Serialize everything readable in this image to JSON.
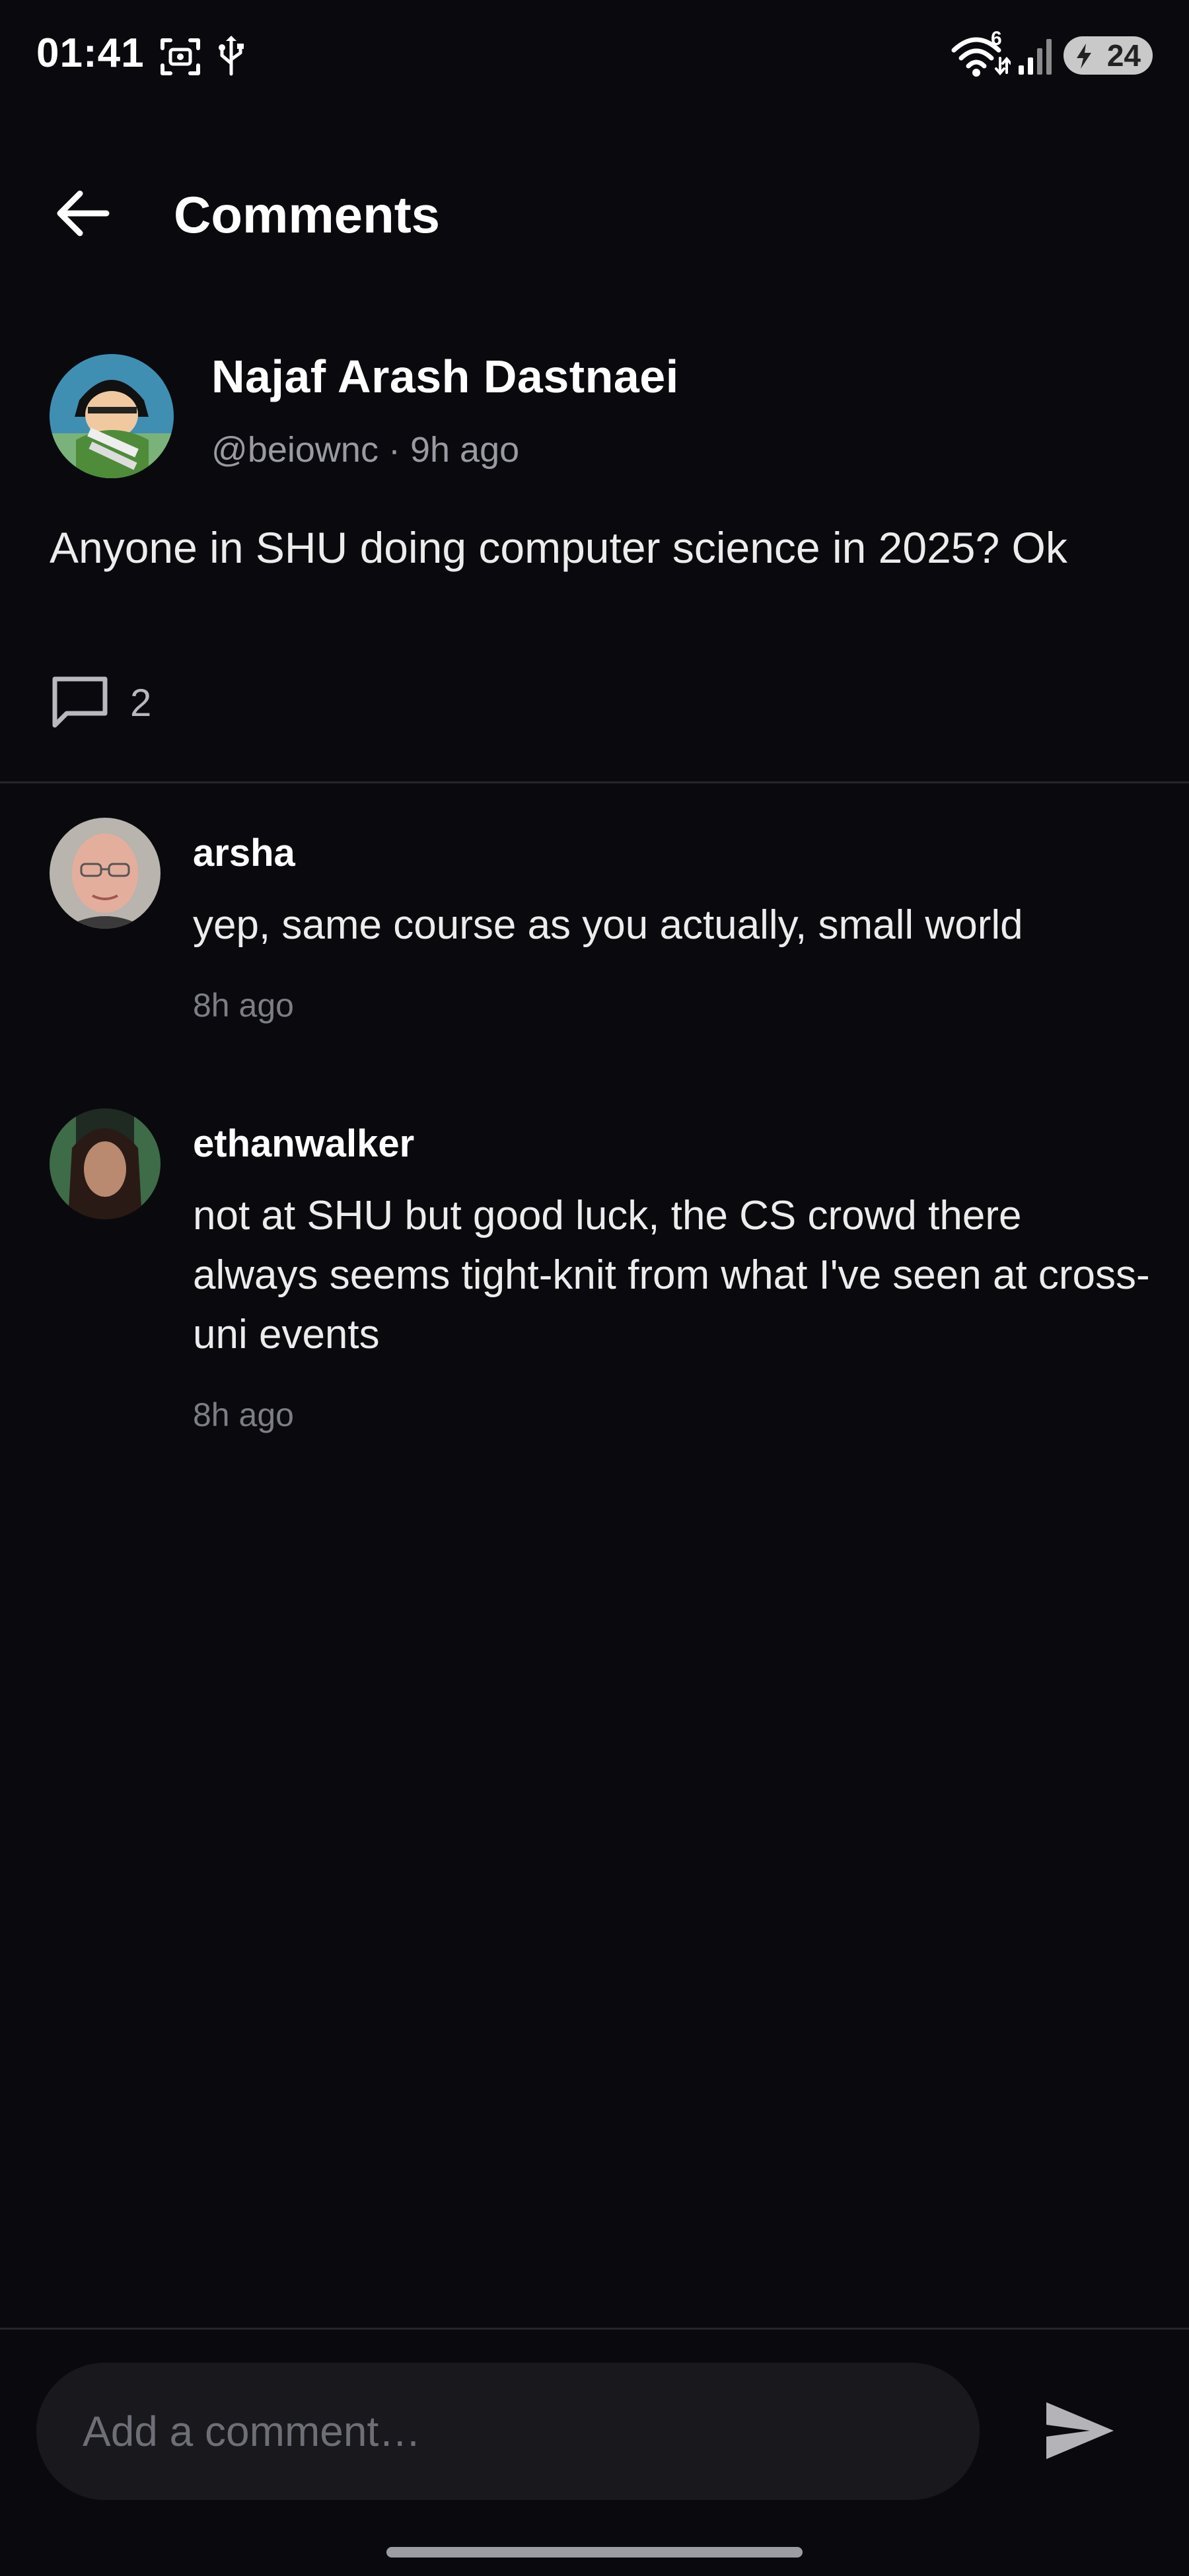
{
  "status_bar": {
    "time": "01:41",
    "battery_level": "24",
    "wifi_badge": "6",
    "icons": [
      "screenshot-icon",
      "usb-icon",
      "wifi-icon",
      "signal-icon",
      "battery-icon"
    ]
  },
  "header": {
    "title": "Comments",
    "back_icon": "arrow-left-icon"
  },
  "post": {
    "author_name": "Najaf Arash Dastnaei",
    "handle": "@beiownc",
    "separator": "·",
    "time_ago": "9h ago",
    "body": "Anyone in SHU doing computer science in 2025? Ok",
    "comment_count": "2",
    "comment_icon": "comment-bubble-icon"
  },
  "comments": [
    {
      "author": "arsha",
      "text": "yep, same course as you actually, small world",
      "time_ago": "8h ago"
    },
    {
      "author": "ethanwalker",
      "text": "not at SHU but good luck, the CS crowd there always seems tight-knit from what I've seen at cross-uni events",
      "time_ago": "8h ago"
    }
  ],
  "composer": {
    "placeholder": "Add a comment…",
    "value": "",
    "send_icon": "send-icon"
  },
  "colors": {
    "background": "#0a0a0e",
    "input_background": "#18181d",
    "primary_text": "#ffffff",
    "secondary_text": "#9a9aa2",
    "divider": "#25252b"
  }
}
